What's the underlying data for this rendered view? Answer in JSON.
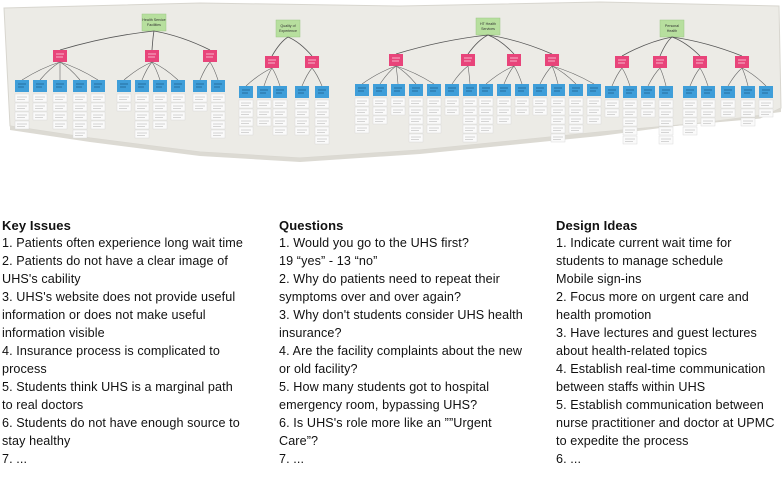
{
  "photo": {
    "categories": [
      {
        "label_line1": "Health Service",
        "label_line2": "Facilities",
        "note_color": "#b7df9e"
      },
      {
        "label_line1": "Quality of",
        "label_line2": "Experience",
        "note_color": "#b7df9e"
      },
      {
        "label_line1": "HT Health",
        "label_line2": "Services",
        "note_color": "#b7df9e"
      },
      {
        "label_line1": "Personal",
        "label_line2": "Health",
        "note_color": "#b7df9e"
      }
    ],
    "colors": {
      "sticky_green": "#b7df9e",
      "sticky_pink": "#e8447a",
      "sticky_blue": "#3f9ed9",
      "paper": "#ecebe6"
    }
  },
  "key_issues": {
    "title": "Key Issues",
    "items": [
      "1. Patients often experience long wait time",
      "2. Patients do not have a clear image of UHS's cability",
      "3. UHS's website does not provide useful information or does not make useful information visible",
      "4. Insurance process is complicated to process",
      "5. Students think UHS is a marginal path to real doctors",
      "6. Students do not have enough source to stay healthy",
      "7. ..."
    ]
  },
  "questions": {
    "title": "Questions",
    "items": [
      "1. Would you go to the UHS first?",
      "19 “yes” - 13 “no”",
      "2. Why do patients need to repeat their symptoms over and over again?",
      "3. Why don't students consider UHS health insurance?",
      "4. Are the facility complaints about the new or old facility?",
      "5. How many students got to hospital emergency room, bypassing UHS?",
      "6. Is UHS's role more like an ””Urgent Care”?",
      "7. ..."
    ]
  },
  "design_ideas": {
    "title": "Design Ideas",
    "items": [
      "1. Indicate current wait time for students to manage schedule",
      "Mobile sign-ins",
      "2. Focus more on urgent care and health promotion",
      "3. Have lectures and guest lectures about health-related topics",
      "4. Establish real-time communication between staffs within UHS",
      "5. Establish communication between nurse practitioner and doctor at UPMC to expedite the process",
      "6. ..."
    ]
  }
}
